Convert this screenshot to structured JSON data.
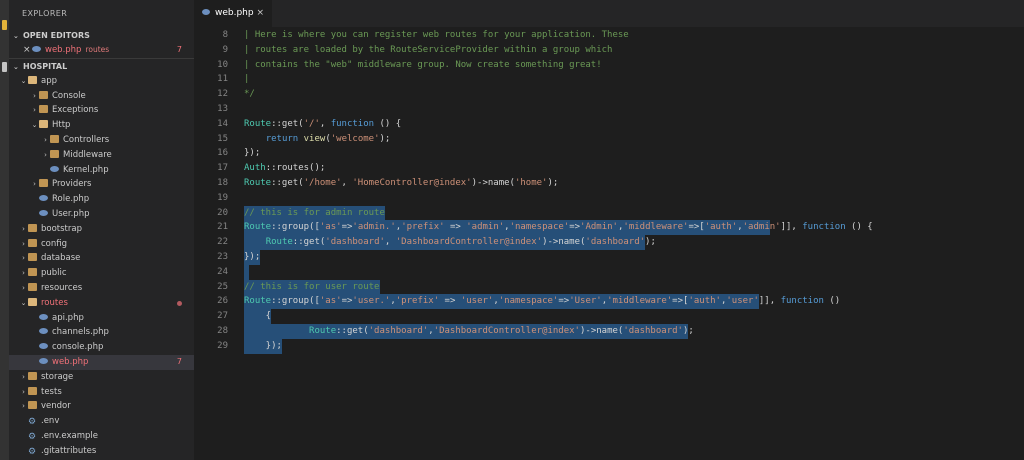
{
  "colors": {
    "background": "#1e1e1e",
    "sidebar": "#252526",
    "selection": "#264f78",
    "comment": "#6a9955",
    "keyword": "#569cd6",
    "class": "#4ec9b0",
    "string": "#ce9178",
    "function": "#dcdcaa",
    "text": "#d4d4d4",
    "error": "#f07178"
  },
  "sidebar": {
    "title": "EXPLORER",
    "open_editors": {
      "label": "OPEN EDITORS",
      "items": [
        {
          "name": "web.php",
          "dir": "routes",
          "count": "7"
        }
      ]
    },
    "project": {
      "label": "HOSPITAL",
      "tree": [
        {
          "name": "app",
          "chev": "⌄",
          "icon": "folder-open",
          "depth": 0
        },
        {
          "name": "Console",
          "chev": "›",
          "icon": "folder",
          "depth": 1
        },
        {
          "name": "Exceptions",
          "chev": "›",
          "icon": "folder",
          "depth": 1
        },
        {
          "name": "Http",
          "chev": "⌄",
          "icon": "folder-open",
          "depth": 1
        },
        {
          "name": "Controllers",
          "chev": "›",
          "icon": "folder",
          "depth": 2
        },
        {
          "name": "Middleware",
          "chev": "›",
          "icon": "folder",
          "depth": 2
        },
        {
          "name": "Kernel.php",
          "chev": "",
          "icon": "php",
          "depth": 2
        },
        {
          "name": "Providers",
          "chev": "›",
          "icon": "folder",
          "depth": 1
        },
        {
          "name": "Role.php",
          "chev": "",
          "icon": "php",
          "depth": 1
        },
        {
          "name": "User.php",
          "chev": "",
          "icon": "php",
          "depth": 1
        },
        {
          "name": "bootstrap",
          "chev": "›",
          "icon": "folder",
          "depth": 0
        },
        {
          "name": "config",
          "chev": "›",
          "icon": "folder",
          "depth": 0
        },
        {
          "name": "database",
          "chev": "›",
          "icon": "folder",
          "depth": 0
        },
        {
          "name": "public",
          "chev": "›",
          "icon": "folder",
          "depth": 0
        },
        {
          "name": "resources",
          "chev": "›",
          "icon": "folder",
          "depth": 0
        },
        {
          "name": "routes",
          "chev": "⌄",
          "icon": "folder-open",
          "depth": 0,
          "status": "error-dot"
        },
        {
          "name": "api.php",
          "chev": "",
          "icon": "php",
          "depth": 1
        },
        {
          "name": "channels.php",
          "chev": "",
          "icon": "php",
          "depth": 1
        },
        {
          "name": "console.php",
          "chev": "",
          "icon": "php",
          "depth": 1
        },
        {
          "name": "web.php",
          "chev": "",
          "icon": "php",
          "depth": 1,
          "status": "error",
          "count": "7",
          "active": true
        },
        {
          "name": "storage",
          "chev": "›",
          "icon": "folder",
          "depth": 0
        },
        {
          "name": "tests",
          "chev": "›",
          "icon": "folder",
          "depth": 0
        },
        {
          "name": "vendor",
          "chev": "›",
          "icon": "folder",
          "depth": 0
        },
        {
          "name": ".env",
          "chev": "",
          "icon": "gear",
          "depth": 0
        },
        {
          "name": ".env.example",
          "chev": "",
          "icon": "gear",
          "depth": 0
        },
        {
          "name": ".gitattributes",
          "chev": "",
          "icon": "gear",
          "depth": 0
        }
      ]
    }
  },
  "editor": {
    "tab": {
      "label": "web.php",
      "close": "×"
    },
    "lines": [
      {
        "n": "8",
        "tokens": [
          [
            "c",
            "| Here is where you can register web routes for your application. These"
          ]
        ]
      },
      {
        "n": "9",
        "tokens": [
          [
            "c",
            "| routes are loaded by the RouteServiceProvider within a group which"
          ]
        ]
      },
      {
        "n": "10",
        "tokens": [
          [
            "c",
            "| contains the \"web\" middleware group. Now create something great!"
          ]
        ]
      },
      {
        "n": "11",
        "tokens": [
          [
            "c",
            "|"
          ]
        ]
      },
      {
        "n": "12",
        "tokens": [
          [
            "c",
            "*/"
          ]
        ]
      },
      {
        "n": "13",
        "tokens": []
      },
      {
        "n": "14",
        "tokens": [
          [
            "cl",
            "Route"
          ],
          [
            "p",
            "::get("
          ],
          [
            "s",
            "'/'"
          ],
          [
            "p",
            ", "
          ],
          [
            "k",
            "function"
          ],
          [
            "p",
            " () {"
          ]
        ]
      },
      {
        "n": "15",
        "tokens": [
          [
            "p",
            "    "
          ],
          [
            "k",
            "return"
          ],
          [
            "p",
            " "
          ],
          [
            "f",
            "view"
          ],
          [
            "p",
            "("
          ],
          [
            "s",
            "'welcome'"
          ],
          [
            "p",
            ");"
          ]
        ]
      },
      {
        "n": "16",
        "tokens": [
          [
            "p",
            "});"
          ]
        ]
      },
      {
        "n": "17",
        "tokens": [
          [
            "cl",
            "Auth"
          ],
          [
            "p",
            "::routes();"
          ]
        ]
      },
      {
        "n": "18",
        "tokens": [
          [
            "cl",
            "Route"
          ],
          [
            "p",
            "::get("
          ],
          [
            "s",
            "'/home'"
          ],
          [
            "p",
            ", "
          ],
          [
            "s",
            "'HomeController@index'"
          ],
          [
            "p",
            ")->name("
          ],
          [
            "s",
            "'home'"
          ],
          [
            "p",
            ");"
          ]
        ]
      },
      {
        "n": "19",
        "tokens": []
      },
      {
        "n": "20",
        "sel": 26,
        "tokens": [
          [
            "c",
            "// this is for admin route"
          ]
        ]
      },
      {
        "n": "21",
        "sel": 97,
        "tokens": [
          [
            "cl",
            "Route"
          ],
          [
            "p",
            "::group(["
          ],
          [
            "s",
            "'as'"
          ],
          [
            "p",
            "=>"
          ],
          [
            "s",
            "'admin.'"
          ],
          [
            "p",
            ","
          ],
          [
            "s",
            "'prefix'"
          ],
          [
            "p",
            " => "
          ],
          [
            "s",
            "'admin'"
          ],
          [
            "p",
            ","
          ],
          [
            "s",
            "'namespace'"
          ],
          [
            "p",
            "=>"
          ],
          [
            "s",
            "'Admin'"
          ],
          [
            "p",
            ","
          ],
          [
            "s",
            "'middleware'"
          ],
          [
            "p",
            "=>["
          ],
          [
            "s",
            "'auth'"
          ],
          [
            "p",
            ","
          ],
          [
            "s",
            "'admin'"
          ],
          [
            "p",
            "]], "
          ],
          [
            "k",
            "function"
          ],
          [
            "p",
            " () {"
          ]
        ]
      },
      {
        "n": "22",
        "sel": 74,
        "tokens": [
          [
            "p",
            "    "
          ],
          [
            "cl",
            "Route"
          ],
          [
            "p",
            "::get("
          ],
          [
            "s",
            "'dashboard'"
          ],
          [
            "p",
            ", "
          ],
          [
            "s",
            "'DashboardController@index'"
          ],
          [
            "p",
            ")->name("
          ],
          [
            "s",
            "'dashboard'"
          ],
          [
            "p",
            ");"
          ]
        ]
      },
      {
        "n": "23",
        "sel": 3,
        "tokens": [
          [
            "p",
            "});"
          ]
        ]
      },
      {
        "n": "24",
        "sel": 1,
        "tokens": []
      },
      {
        "n": "25",
        "sel": 25,
        "tokens": [
          [
            "c",
            "// this is for user route"
          ]
        ]
      },
      {
        "n": "26",
        "sel": 95,
        "tokens": [
          [
            "cl",
            "Route"
          ],
          [
            "p",
            "::group(["
          ],
          [
            "s",
            "'as'"
          ],
          [
            "p",
            "=>"
          ],
          [
            "s",
            "'user.'"
          ],
          [
            "p",
            ","
          ],
          [
            "s",
            "'prefix'"
          ],
          [
            "p",
            " => "
          ],
          [
            "s",
            "'user'"
          ],
          [
            "p",
            ","
          ],
          [
            "s",
            "'namespace'"
          ],
          [
            "p",
            "=>"
          ],
          [
            "s",
            "'User'"
          ],
          [
            "p",
            ","
          ],
          [
            "s",
            "'middleware'"
          ],
          [
            "p",
            "=>["
          ],
          [
            "s",
            "'auth'"
          ],
          [
            "p",
            ","
          ],
          [
            "s",
            "'user'"
          ],
          [
            "p",
            "]], "
          ],
          [
            "k",
            "function"
          ],
          [
            "p",
            " ()"
          ]
        ]
      },
      {
        "n": "27",
        "sel": 5,
        "tokens": [
          [
            "p",
            "    {"
          ]
        ]
      },
      {
        "n": "28",
        "sel": 82,
        "tokens": [
          [
            "p",
            "            "
          ],
          [
            "cl",
            "Route"
          ],
          [
            "p",
            "::get("
          ],
          [
            "s",
            "'dashboard'"
          ],
          [
            "p",
            ","
          ],
          [
            "s",
            "'DashboardController@index'"
          ],
          [
            "p",
            ")->name("
          ],
          [
            "s",
            "'dashboard'"
          ],
          [
            "p",
            ");"
          ]
        ]
      },
      {
        "n": "29",
        "sel": 7,
        "tokens": [
          [
            "p",
            "    });"
          ]
        ]
      }
    ]
  }
}
